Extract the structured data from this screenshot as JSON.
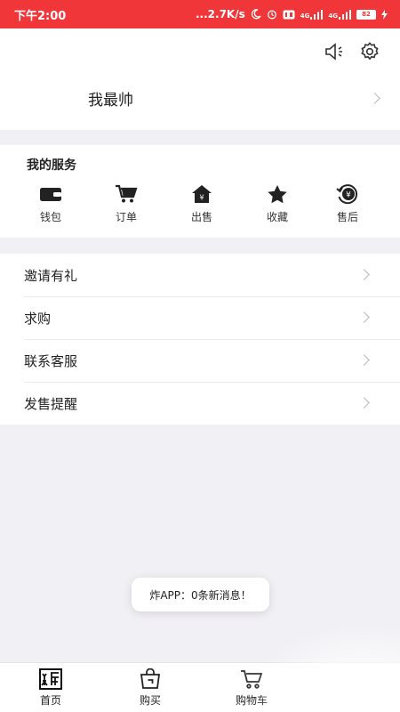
{
  "status_bar": {
    "time": "下午2:00",
    "network_speed": "...2.7K/s",
    "signal_1_label": "4G",
    "signal_2_label": "4G",
    "battery": "82"
  },
  "profile": {
    "name": "我最帅"
  },
  "services": {
    "title": "我的服务",
    "items": [
      {
        "label": "钱包",
        "icon": "wallet-icon"
      },
      {
        "label": "订单",
        "icon": "cart-icon"
      },
      {
        "label": "出售",
        "icon": "sell-house-icon"
      },
      {
        "label": "收藏",
        "icon": "star-icon"
      },
      {
        "label": "售后",
        "icon": "after-sales-icon"
      }
    ]
  },
  "menu": {
    "items": [
      {
        "label": "邀请有礼"
      },
      {
        "label": "求购"
      },
      {
        "label": "联系客服"
      },
      {
        "label": "发售提醒"
      }
    ]
  },
  "toast": {
    "message": "炸APP：0条新消息！"
  },
  "tabbar": {
    "items": [
      {
        "label": "首页",
        "icon": "home-logo-icon"
      },
      {
        "label": "购买",
        "icon": "shopping-bag-icon"
      },
      {
        "label": "购物车",
        "icon": "cart-icon"
      }
    ]
  },
  "colors": {
    "status_bar": "#f1363a",
    "background": "#f1f0f5"
  }
}
